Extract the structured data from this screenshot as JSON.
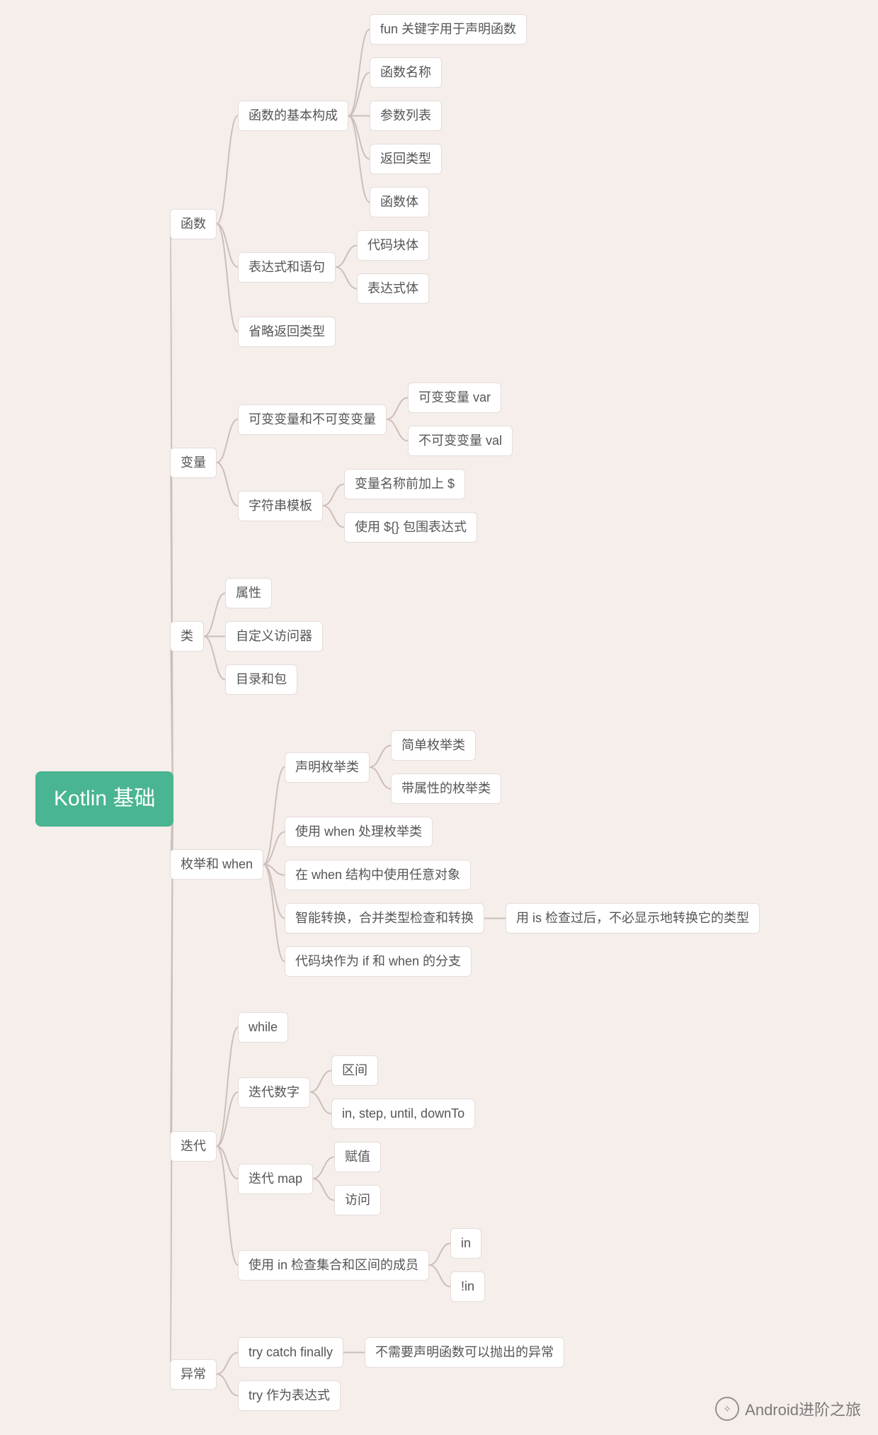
{
  "tree": {
    "label": "Kotlin 基础",
    "children": [
      {
        "label": "函数",
        "children": [
          {
            "label": "函数的基本构成",
            "children": [
              {
                "label": "fun 关键字用于声明函数"
              },
              {
                "label": "函数名称"
              },
              {
                "label": "参数列表"
              },
              {
                "label": "返回类型"
              },
              {
                "label": "函数体"
              }
            ]
          },
          {
            "label": "表达式和语句",
            "children": [
              {
                "label": "代码块体"
              },
              {
                "label": "表达式体"
              }
            ]
          },
          {
            "label": "省略返回类型"
          }
        ]
      },
      {
        "label": "变量",
        "children": [
          {
            "label": "可变变量和不可变变量",
            "children": [
              {
                "label": "可变变量 var"
              },
              {
                "label": "不可变变量 val"
              }
            ]
          },
          {
            "label": "字符串模板",
            "children": [
              {
                "label": "变量名称前加上 $"
              },
              {
                "label": "使用 ${} 包围表达式"
              }
            ]
          }
        ]
      },
      {
        "label": "类",
        "children": [
          {
            "label": "属性"
          },
          {
            "label": "自定义访问器"
          },
          {
            "label": "目录和包"
          }
        ]
      },
      {
        "label": "枚举和 when",
        "children": [
          {
            "label": "声明枚举类",
            "children": [
              {
                "label": "简单枚举类"
              },
              {
                "label": "带属性的枚举类"
              }
            ]
          },
          {
            "label": "使用 when 处理枚举类"
          },
          {
            "label": "在 when 结构中使用任意对象"
          },
          {
            "label": "智能转换，合并类型检查和转换",
            "children": [
              {
                "label": "用 is 检查过后，不必显示地转换它的类型"
              }
            ]
          },
          {
            "label": "代码块作为 if 和 when 的分支"
          }
        ]
      },
      {
        "label": "迭代",
        "children": [
          {
            "label": "while"
          },
          {
            "label": "迭代数字",
            "children": [
              {
                "label": "区间"
              },
              {
                "label": "in, step, until, downTo"
              }
            ]
          },
          {
            "label": "迭代 map",
            "children": [
              {
                "label": "赋值"
              },
              {
                "label": "访问"
              }
            ]
          },
          {
            "label": "使用 in 检查集合和区间的成员",
            "children": [
              {
                "label": "in"
              },
              {
                "label": "!in"
              }
            ]
          }
        ]
      },
      {
        "label": "异常",
        "children": [
          {
            "label": "try catch finally",
            "children": [
              {
                "label": "不需要声明函数可以抛出的异常"
              }
            ]
          },
          {
            "label": "try 作为表达式"
          }
        ]
      }
    ]
  },
  "layout": {
    "rootX": 50,
    "colXs": [
      240,
      320,
      440
    ],
    "colGaps": [
      60,
      30,
      30,
      30
    ],
    "leafGap": 18,
    "branchGap": 50,
    "topPad": 20
  },
  "watermark": {
    "text": "Android进阶之旅"
  }
}
